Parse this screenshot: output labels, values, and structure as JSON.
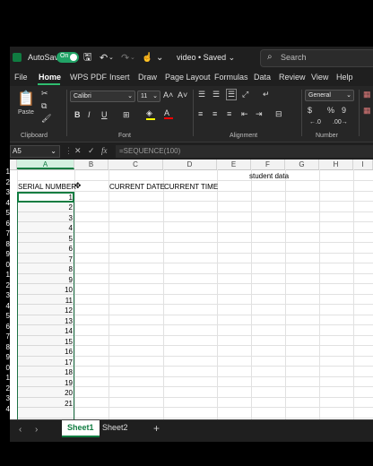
{
  "app": {
    "autosave_label": "AutoSave",
    "autosave_state": "On",
    "doc_title": "video • Saved ⌄",
    "search_placeholder": "Search",
    "accent_color": "#107c41"
  },
  "menu": [
    "File",
    "Home",
    "WPS PDF",
    "Insert",
    "Draw",
    "Page Layout",
    "Formulas",
    "Data",
    "Review",
    "View",
    "Help"
  ],
  "ribbon": {
    "paste_label": "Paste",
    "clipboard_group": "Clipboard",
    "font_name": "Calibri",
    "font_size": "11",
    "font_group": "Font",
    "alignment_group": "Alignment",
    "number_format": "General",
    "number_group": "Number",
    "bold": "B",
    "italic": "I",
    "underline": "U",
    "grow_font": "A˄",
    "shrink_font": "A˅",
    "currency": "$",
    "percent": "%",
    "comma": "9"
  },
  "formula_bar": {
    "name_box": "A5",
    "formula": "=SEQUENCE(100)"
  },
  "columns": [
    "A",
    "B",
    "C",
    "D",
    "E",
    "F",
    "G",
    "H",
    "I"
  ],
  "title_cell": "student data",
  "headers": {
    "serial": "SERIAL NUMBER",
    "date": "CURRENT DATE",
    "time": "CURRENT TIME"
  },
  "row_numbers_visible": [
    "1",
    "2",
    "3",
    "4",
    "5",
    "6",
    "7",
    "8",
    "9",
    "0",
    "1",
    "2",
    "3",
    "4",
    "5",
    "6",
    "7",
    "8",
    "9",
    "0",
    "1",
    "2",
    "3",
    "4"
  ],
  "serial_values": [
    "1",
    "2",
    "3",
    "4",
    "5",
    "6",
    "7",
    "8",
    "9",
    "10",
    "11",
    "12",
    "13",
    "14",
    "15",
    "16",
    "17",
    "18",
    "19",
    "20",
    "21"
  ],
  "sheets": [
    "Sheet1",
    "Sheet2"
  ],
  "add_sheet": "+"
}
